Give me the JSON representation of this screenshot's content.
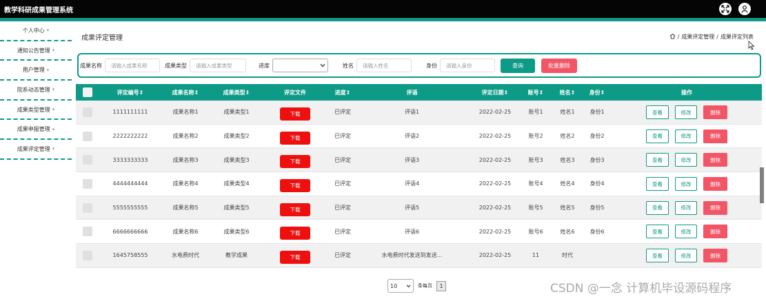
{
  "app": {
    "title": "教学科研成果管理系统"
  },
  "sidebar": {
    "items": [
      {
        "label": "个人中心"
      },
      {
        "label": "通知公告管理"
      },
      {
        "label": "用户管理"
      },
      {
        "label": "院系动态管理"
      },
      {
        "label": "成果类型管理"
      },
      {
        "label": "成果申报管理"
      },
      {
        "label": "成果评定管理"
      }
    ]
  },
  "page": {
    "title": "成果评定管理",
    "breadcrumb": [
      "成果评定管理",
      "成果评定列表"
    ],
    "breadcrumb_sep": "/"
  },
  "search": {
    "fields": [
      {
        "label": "成果名称",
        "placeholder": "请输入成果名称"
      },
      {
        "label": "成果类型",
        "placeholder": "请输入成果类型"
      },
      {
        "label": "进度",
        "value": ""
      },
      {
        "label": "姓名",
        "placeholder": "请输入姓名"
      },
      {
        "label": "身份",
        "placeholder": "请输入身份"
      }
    ],
    "query_label": "查询",
    "batch_delete_label": "批量删除"
  },
  "table": {
    "columns": [
      "评定编号",
      "成果名称",
      "成果类型",
      "评定文件",
      "进度",
      "评语",
      "评定日期",
      "账号",
      "姓名",
      "身份",
      "操作"
    ],
    "sort_mark": "⇕",
    "download_label": "下载",
    "view_label": "查看",
    "edit_label": "修改",
    "delete_label": "删除",
    "rows": [
      {
        "id": "1111111111",
        "name": "成果名称1",
        "type": "成果类型1",
        "progress": "已评定",
        "comment": "评语1",
        "date": "2022-02-25",
        "account": "账号1",
        "person": "姓名1",
        "identity": "身份1"
      },
      {
        "id": "2222222222",
        "name": "成果名称2",
        "type": "成果类型2",
        "progress": "已评定",
        "comment": "评语2",
        "date": "2022-02-25",
        "account": "账号2",
        "person": "姓名2",
        "identity": "身份2"
      },
      {
        "id": "3333333333",
        "name": "成果名称3",
        "type": "成果类型3",
        "progress": "已评定",
        "comment": "评语3",
        "date": "2022-02-25",
        "account": "账号3",
        "person": "姓名3",
        "identity": "身份3"
      },
      {
        "id": "4444444444",
        "name": "成果名称4",
        "type": "成果类型4",
        "progress": "已评定",
        "comment": "评语4",
        "date": "2022-02-25",
        "account": "账号4",
        "person": "姓名4",
        "identity": "身份4"
      },
      {
        "id": "5555555555",
        "name": "成果名称5",
        "type": "成果类型5",
        "progress": "已评定",
        "comment": "评语5",
        "date": "2022-02-25",
        "account": "账号5",
        "person": "姓名5",
        "identity": "身份5"
      },
      {
        "id": "6666666666",
        "name": "成果名称6",
        "type": "成果类型6",
        "progress": "已评定",
        "comment": "评语6",
        "date": "2022-02-25",
        "account": "账号6",
        "person": "姓名6",
        "identity": "身份6"
      },
      {
        "id": "1645758555",
        "name": "水电费时代",
        "type": "教学成果",
        "progress": "已评定",
        "comment": "水电费时代发送到发送...",
        "date": "2022-02-25",
        "account": "11",
        "person": "时代",
        "identity": ""
      }
    ]
  },
  "pagination": {
    "page_size": "10",
    "page_size_suffix": "条每页",
    "current_page": "1"
  },
  "watermark": "CSDN @一念 计算机毕设源码程序",
  "colors": {
    "primary": "#0d9a86",
    "danger": "#f25666",
    "download": "#ef0f0f",
    "topbar": "#050505"
  },
  "icons": {
    "fullscreen": "fullscreen-icon",
    "user": "user-icon",
    "home": "home-icon",
    "select_arrow": "chevron-down-icon"
  }
}
